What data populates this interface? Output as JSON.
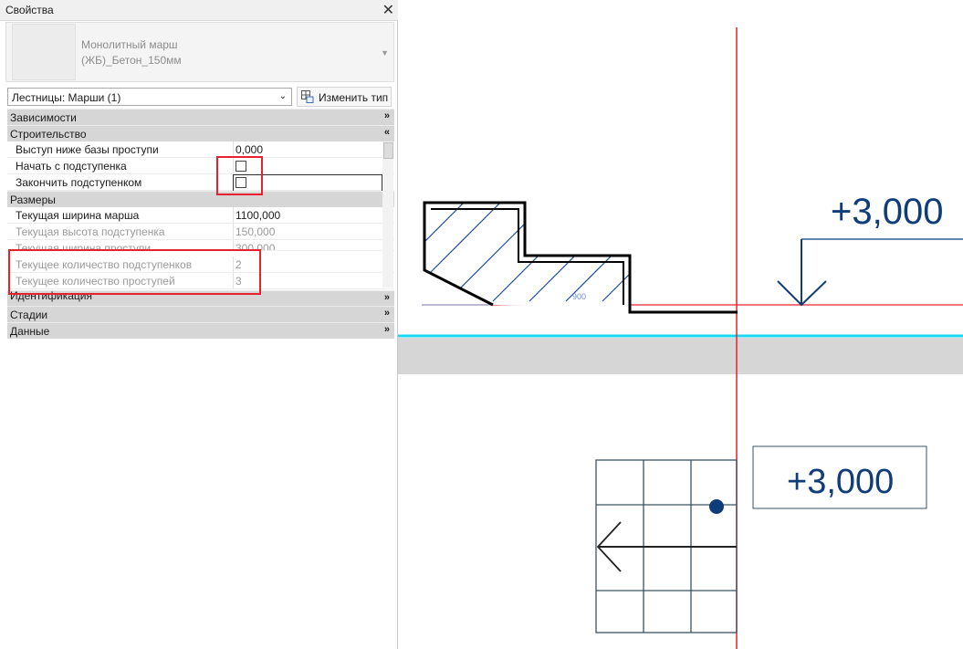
{
  "properties_panel": {
    "title": "Свойства",
    "close_icon": "close-icon",
    "type_selector": {
      "line1": "Монолитный марш",
      "line2": "(ЖБ)_Бетон_150мм"
    },
    "filter_value": "Лестницы: Марши (1)",
    "edit_type_label": "Изменить тип",
    "groups": {
      "dependencies": "Зависимости",
      "construction": "Строительство",
      "dimensions": "Размеры",
      "identity": "Идентификация",
      "phases": "Стадии",
      "data": "Данные"
    },
    "construction_params": {
      "extend_below_base_label": "Выступ ниже базы проступи",
      "extend_below_base_value": "0,000",
      "begin_with_riser_label": "Начать с подступенка",
      "begin_with_riser_checked": false,
      "end_with_riser_label": "Закончить подступенком",
      "end_with_riser_checked": false
    },
    "dimension_params": {
      "run_width_label": "Текущая ширина марша",
      "run_width_value": "1100,000",
      "riser_height_label": "Текущая высота подступенка",
      "riser_height_value": "150,000",
      "tread_depth_label": "Текущая ширина проступи",
      "tread_depth_value": "300,000",
      "risers_count_label": "Текущее количество подступенков",
      "risers_count_value": "2",
      "treads_count_label": "Текущее количество проступей",
      "treads_count_value": "3"
    }
  },
  "drawing": {
    "section_level": "+3,000",
    "section_dimension": "900",
    "plan_level": "+3,000",
    "colors": {
      "level_line": "#e8212e",
      "cut_line": "#13d8f0",
      "annotation": "#0f3d7a",
      "hatch": "#1f4f9a",
      "highlight": "#e8212e"
    }
  }
}
